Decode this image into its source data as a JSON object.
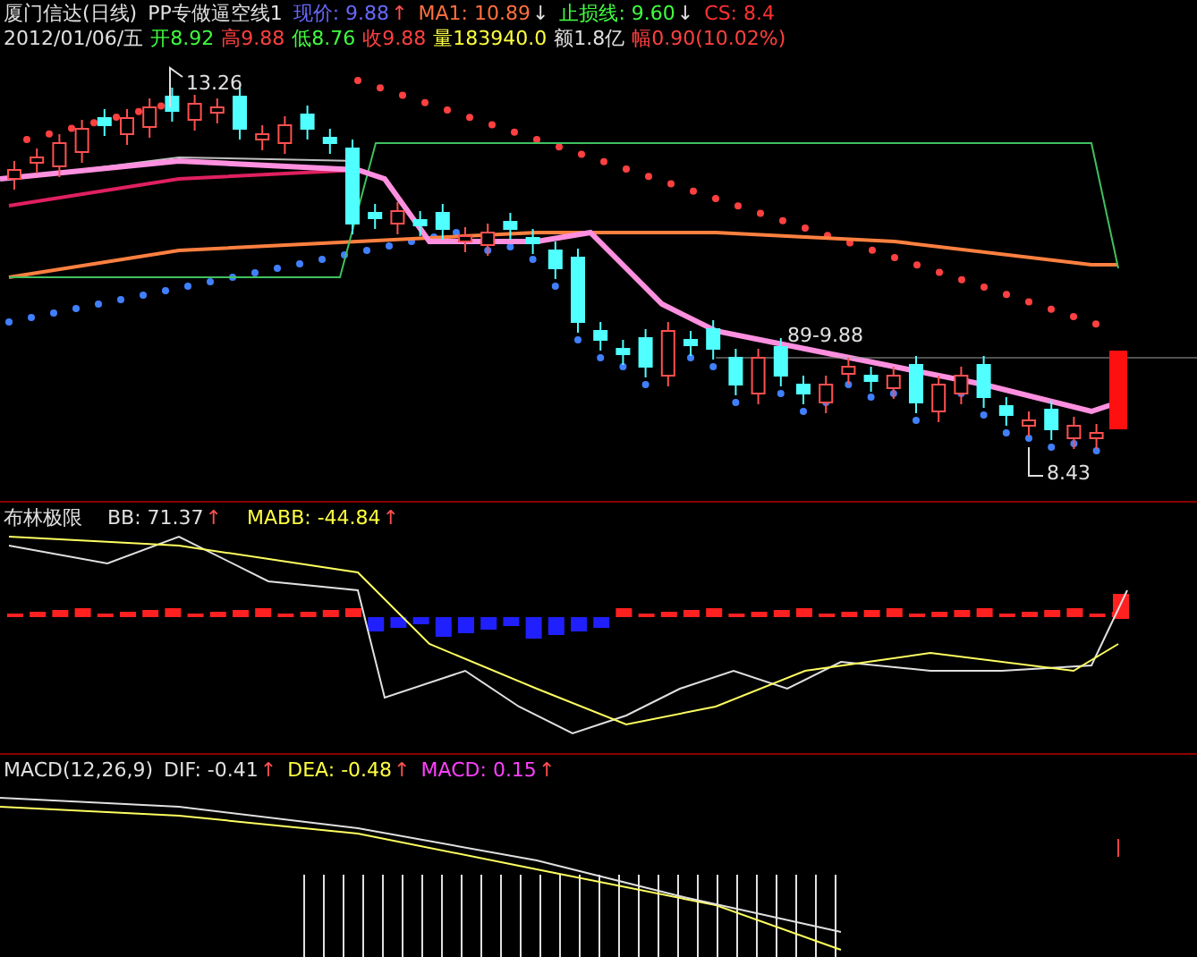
{
  "main": {
    "title": "厦门信达(日线)",
    "indicator": "PP专做逼空线1",
    "readouts": [
      {
        "text": "现价: 9.88",
        "color": "#6868ff",
        "arrow": "↑",
        "rising": true
      },
      {
        "text": "MA1: 10.89",
        "color": "#ff7040",
        "arrow": "↓",
        "rising": false
      },
      {
        "text": "止损线: 9.60",
        "color": "#40ff40",
        "arrow": "↓",
        "rising": false
      },
      {
        "text": "CS: 8.4",
        "color": "#ff3030"
      }
    ],
    "quote": [
      {
        "text": "2012/01/06/五",
        "color": "#e0e0e0"
      },
      {
        "text": "开8.92",
        "color": "#40ff40"
      },
      {
        "text": "高9.88",
        "color": "#ff4040"
      },
      {
        "text": "低8.76",
        "color": "#40ff40"
      },
      {
        "text": "收9.88",
        "color": "#ff4040"
      },
      {
        "text": "量183940.0",
        "color": "#ffff40"
      },
      {
        "text": "额1.8亿",
        "color": "#e0e0e0"
      },
      {
        "text": "幅0.90(10.02%)",
        "color": "#ff4040"
      }
    ],
    "labels": [
      {
        "kind": "high",
        "text": "13.26"
      },
      {
        "kind": "range",
        "text": "89-9.88"
      },
      {
        "kind": "low",
        "text": "8.43"
      }
    ]
  },
  "bollinger": {
    "title": "布林极限",
    "readouts": [
      {
        "text": "BB: 71.37",
        "color": "#e0e0e0",
        "arrow": "↑",
        "rising": true
      },
      {
        "text": "MABB: -44.84",
        "color": "#ffff40",
        "arrow": "↑",
        "rising": true
      }
    ]
  },
  "macd": {
    "title": "MACD(12,26,9)",
    "readouts": [
      {
        "text": "DIF: -0.41",
        "color": "#e0e0e0",
        "arrow": "↑",
        "rising": true
      },
      {
        "text": "DEA: -0.48",
        "color": "#ffff40",
        "arrow": "↑",
        "rising": true
      },
      {
        "text": "MACD: 0.15",
        "color": "#ff40ff",
        "arrow": "↑",
        "rising": true
      }
    ]
  }
}
